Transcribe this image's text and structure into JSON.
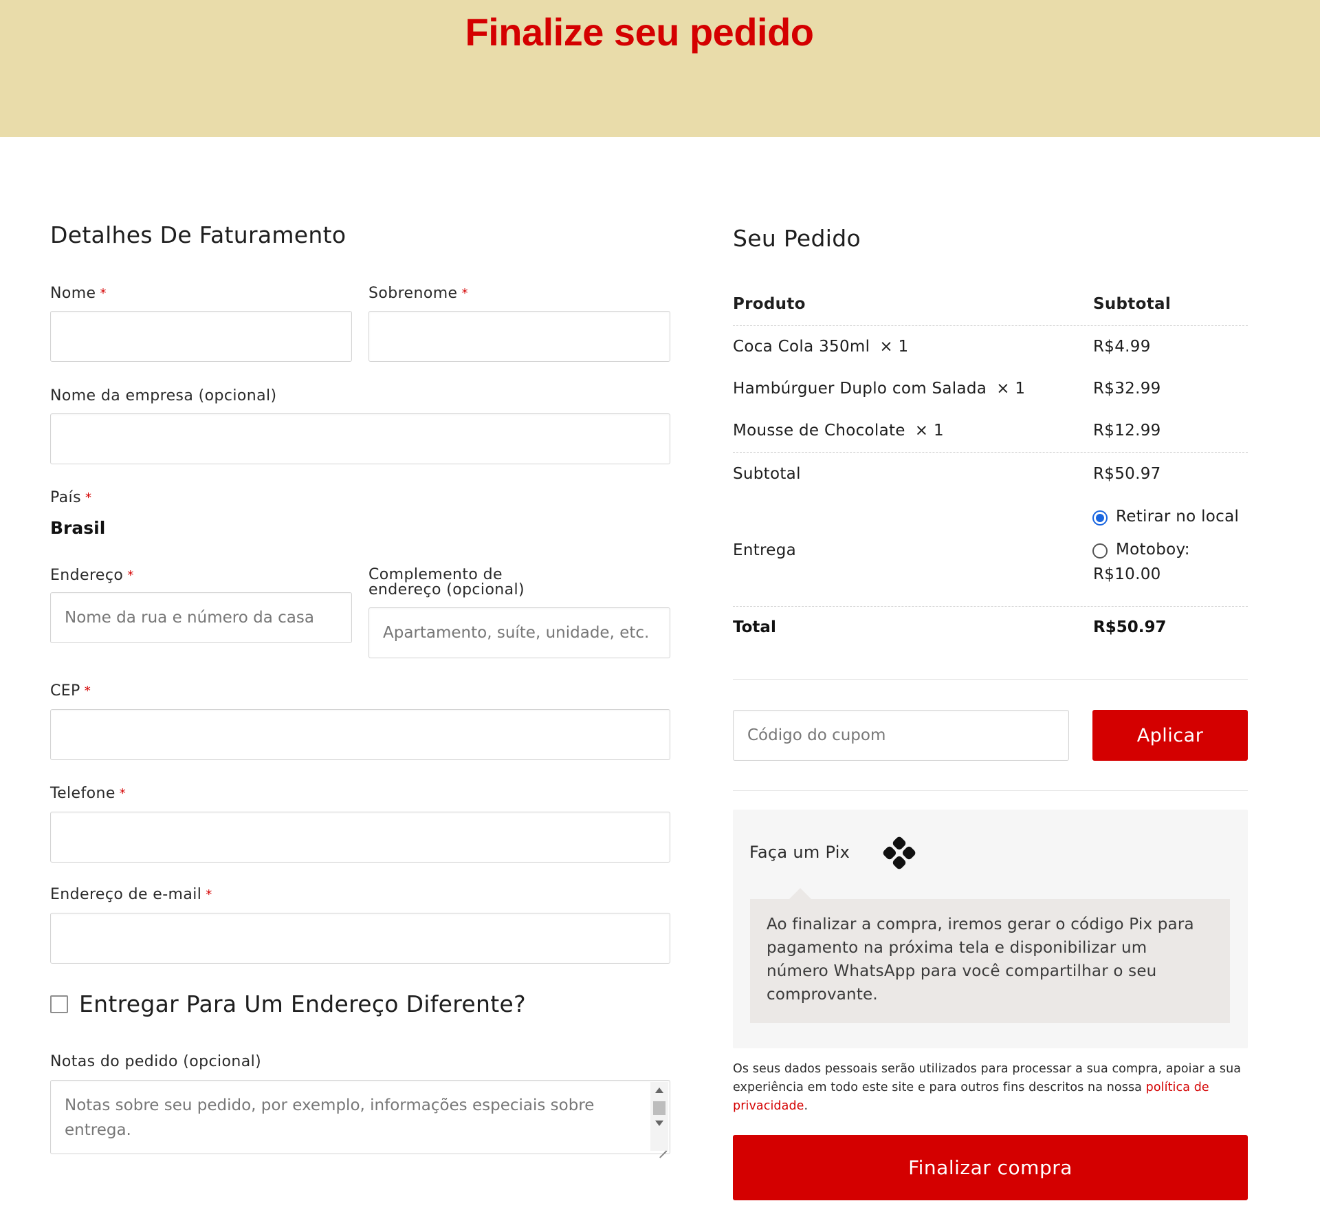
{
  "header": {
    "title": "Finalize seu pedido"
  },
  "billing": {
    "title": "Detalhes De Faturamento",
    "first_name_label": "Nome",
    "last_name_label": "Sobrenome",
    "company_label": "Nome da empresa (opcional)",
    "country_label": "País",
    "country_value": "Brasil",
    "address_label": "Endereço",
    "address_placeholder": "Nome da rua e número da casa",
    "address2_label_line1": "Complemento de",
    "address2_label_line2": "endereço (opcional)",
    "address2_placeholder": "Apartamento, suíte, unidade, etc.",
    "postcode_label": "CEP",
    "phone_label": "Telefone",
    "email_label": "Endereço de e-mail",
    "required_mark": "*",
    "ship_different_label": "Entregar Para Um Endereço Diferente?",
    "notes_label": "Notas do pedido (opcional)",
    "notes_placeholder": "Notas sobre seu pedido, por exemplo, informações especiais sobre entrega."
  },
  "order": {
    "title": "Seu Pedido",
    "col_product": "Produto",
    "col_subtotal": "Subtotal",
    "items": [
      {
        "name": "Coca Cola 350ml",
        "qty": "× 1",
        "price": "R$4.99"
      },
      {
        "name": "Hambúrguer Duplo com Salada",
        "qty": "× 1",
        "price": "R$32.99"
      },
      {
        "name": "Mousse de Chocolate",
        "qty": "× 1",
        "price": "R$12.99"
      }
    ],
    "subtotal_label": "Subtotal",
    "subtotal_value": "R$50.97",
    "shipping_label": "Entrega",
    "shipping_options": [
      {
        "label": "Retirar no local",
        "selected": true
      },
      {
        "label": "Motoboy:",
        "price": "R$10.00",
        "selected": false
      }
    ],
    "total_label": "Total",
    "total_value": "R$50.97"
  },
  "coupon": {
    "placeholder": "Código do cupom",
    "button": "Aplicar"
  },
  "payment": {
    "method_label": "Faça um Pix",
    "icon": "pix-icon",
    "description": "Ao finalizar a compra, iremos gerar o código Pix para pagamento na próxima tela e disponibilizar um número WhatsApp para você compartilhar o seu comprovante."
  },
  "privacy": {
    "text": "Os seus dados pessoais serão utilizados para processar a sua compra, apoiar a sua experiência em todo este site e para outros fins descritos na nossa ",
    "link": "política de privacidade",
    "end": "."
  },
  "checkout_button": "Finalizar compra",
  "colors": {
    "accent": "#d40000",
    "header_bg": "#e9dcaa",
    "radio_selected": "#1a66e0"
  }
}
